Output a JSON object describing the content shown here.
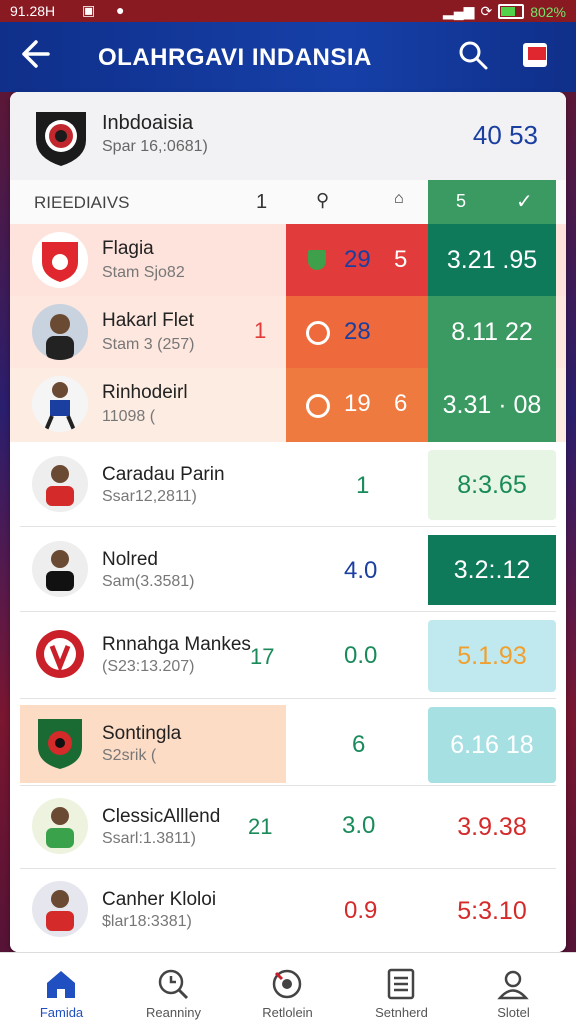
{
  "status_bar": {
    "time": "91.28H",
    "battery": "802%"
  },
  "app_bar": {
    "title": "OLAHRGAVI INDANSIA",
    "icons": [
      "back-arrow-icon",
      "search-icon",
      "flag-icon"
    ]
  },
  "team": {
    "name": "Inbdoaisia",
    "subtitle": "Spar 16,:0681)",
    "score": "40 53"
  },
  "columns": {
    "label": "RIEEDIAIVS",
    "num": "1",
    "pin": "pin-icon",
    "tray": "tray-icon",
    "g1": "5",
    "g2": "check-icon"
  },
  "rows": [
    {
      "name": "Flagia",
      "sub": "Stam Sjo82",
      "left_num": "",
      "stat_a": "29",
      "stat_b": "5",
      "value": "3.21 .95"
    },
    {
      "name": "Hakarl Flet",
      "sub": "Stam 3 (257)",
      "left_num": "1",
      "stat_a": "28",
      "stat_b": "",
      "value": "8.11  22"
    },
    {
      "name": "Rinhodeirl",
      "sub": "11098 (",
      "left_num": "",
      "stat_a": "19",
      "stat_b": "6",
      "value": "3.31 · 08"
    },
    {
      "name": "Caradau Parin",
      "sub": "Ssar12,2811)",
      "left_num": "",
      "stat_a": "1",
      "stat_b": "",
      "value": "8:3.65"
    },
    {
      "name": "Nolred",
      "sub": "Sam(3.3581)",
      "left_num": "",
      "stat_a": "4.0",
      "stat_b": "",
      "value": "3.2:.12"
    },
    {
      "name": "Rnnahga Mankes",
      "sub": "(S23:13.207)",
      "left_num": "17",
      "stat_a": "0.0",
      "stat_b": "",
      "value": "5.1.93"
    },
    {
      "name": "Sontingla",
      "sub": "S2srik (",
      "left_num": "",
      "stat_a": "6",
      "stat_b": "",
      "value": "6.16 18"
    },
    {
      "name": "ClessicAlllend",
      "sub": "Ssarl:1.3811)",
      "left_num": "21",
      "stat_a": "3.0",
      "stat_b": "",
      "value": "3.9.38"
    },
    {
      "name": "Canher Kloloi",
      "sub": "$lar18:3381)",
      "left_num": "",
      "stat_a": "0.9",
      "stat_b": "",
      "value": "5:3.10"
    }
  ],
  "bottom_nav": [
    {
      "label": "Famida",
      "icon": "home-icon"
    },
    {
      "label": "Reanniny",
      "icon": "clock-search-icon"
    },
    {
      "label": "Retlolein",
      "icon": "ball-icon"
    },
    {
      "label": "Setnherd",
      "icon": "list-icon"
    },
    {
      "label": "Slotel",
      "icon": "profile-icon"
    }
  ],
  "colors": {
    "appbar": "#1640a8",
    "red": "#e23b3b",
    "orange": "#ee6a3c",
    "green": "#3a9a62",
    "dark_green": "#0f7a5a"
  }
}
